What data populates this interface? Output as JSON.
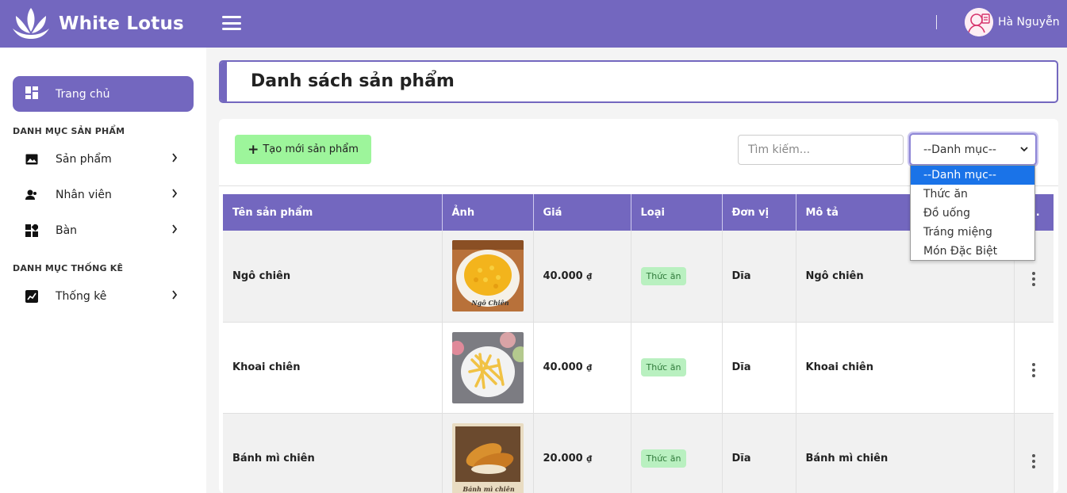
{
  "header": {
    "brand": "White Lotus",
    "user_name": "Hà Nguyễn",
    "icons": {
      "logo": "lotus-logo",
      "menu": "hamburger-icon",
      "avatar": "user-avatar"
    }
  },
  "sidebar": {
    "home": {
      "label": "Trang chủ",
      "icon": "dashboard-icon"
    },
    "sections": [
      {
        "title": "DANH MỤC SẢN PHẨM",
        "items": [
          {
            "label": "Sản phẩm",
            "icon": "image-icon"
          },
          {
            "label": "Nhân viên",
            "icon": "person-icon"
          },
          {
            "label": "Bàn",
            "icon": "grid-icon"
          }
        ]
      },
      {
        "title": "DANH MỤC THỐNG KÊ",
        "items": [
          {
            "label": "Thống kê",
            "icon": "chart-icon"
          }
        ]
      }
    ]
  },
  "main": {
    "page_title": "Danh sách sản phẩm",
    "create_button": "Tạo mới sản phẩm",
    "search_placeholder": "Tìm kiếm...",
    "category_select": {
      "selected": "--Danh mục--",
      "options": [
        "--Danh mục--",
        "Thức ăn",
        "Đồ uống",
        "Tráng miệng",
        "Món Đặc Biệt"
      ]
    },
    "table": {
      "headers": [
        "Tên sản phẩm",
        "Ảnh",
        "Giá",
        "Loại",
        "Đơn vị",
        "Mô tả",
        "..."
      ],
      "rows": [
        {
          "name": "Ngô chiên",
          "image": "fried-corn-photo",
          "price": "40.000",
          "currency": "₫",
          "type": "Thức ăn",
          "unit": "Dĩa",
          "description": "Ngô chiên"
        },
        {
          "name": "Khoai chiên",
          "image": "french-fries-photo",
          "price": "40.000",
          "currency": "₫",
          "type": "Thức ăn",
          "unit": "Dĩa",
          "description": "Khoai chiên"
        },
        {
          "name": "Bánh mì chiên",
          "image": "fried-bread-photo",
          "price": "20.000",
          "currency": "₫",
          "type": "Thức ăn",
          "unit": "Dĩa",
          "description": "Bánh mì chiên"
        }
      ]
    }
  },
  "colors": {
    "primary": "#7367bf",
    "create_button": "#9df59b",
    "badge_bg": "#b9f0c0",
    "badge_text": "#2f7a3a",
    "selected_option": "#1a73e8"
  }
}
